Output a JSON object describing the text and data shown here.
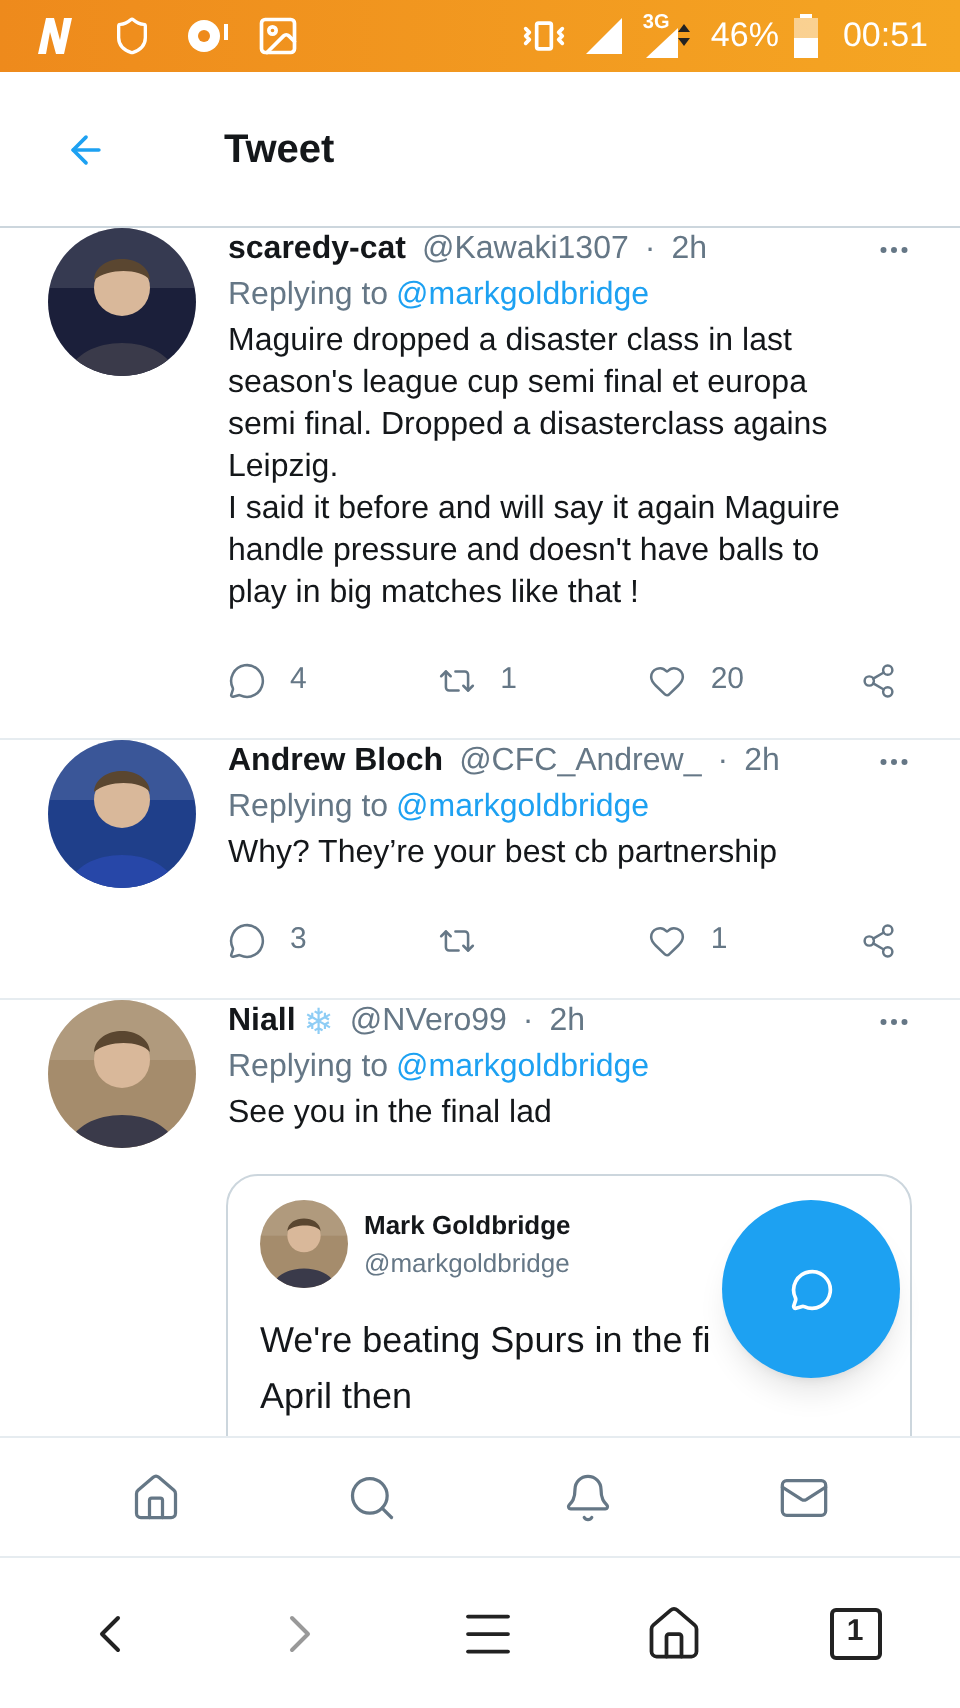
{
  "status_bar": {
    "network": "3G",
    "battery": "46%",
    "time": "00:51"
  },
  "header": {
    "title": "Tweet"
  },
  "tweets": [
    {
      "name": "scaredy-cat",
      "handle": "@Kawaki1307",
      "separator": "·",
      "time": "2h",
      "replying_prefix": "Replying to",
      "replying_to": "@markgoldbridge",
      "text": "Maguire dropped a disaster class in last season's league cup semi final et europa semi final. Dropped a disasterclass agains Leipzig.\nI said it before and will say it again Maguire handle pressure and doesn't have balls to play in big matches like that !",
      "reply_count": "4",
      "retweet_count": "1",
      "like_count": "20"
    },
    {
      "name": "Andrew Bloch",
      "handle": "@CFC_Andrew_",
      "separator": "·",
      "time": "2h",
      "replying_prefix": "Replying to",
      "replying_to": "@markgoldbridge",
      "text": "Why? They’re your best cb partnership",
      "reply_count": "3",
      "like_count": "1"
    },
    {
      "name": "Niall",
      "name_emoji": "❄",
      "handle": "@NVero99",
      "separator": "·",
      "time": "2h",
      "replying_prefix": "Replying to",
      "replying_to": "@markgoldbridge",
      "text": "See you in the final lad",
      "quote": {
        "name": "Mark Goldbridge",
        "handle": "@markgoldbridge",
        "lines": [
          "We're beating Spurs in the fi",
          "April then"
        ]
      }
    }
  ],
  "tab_count": "1"
}
